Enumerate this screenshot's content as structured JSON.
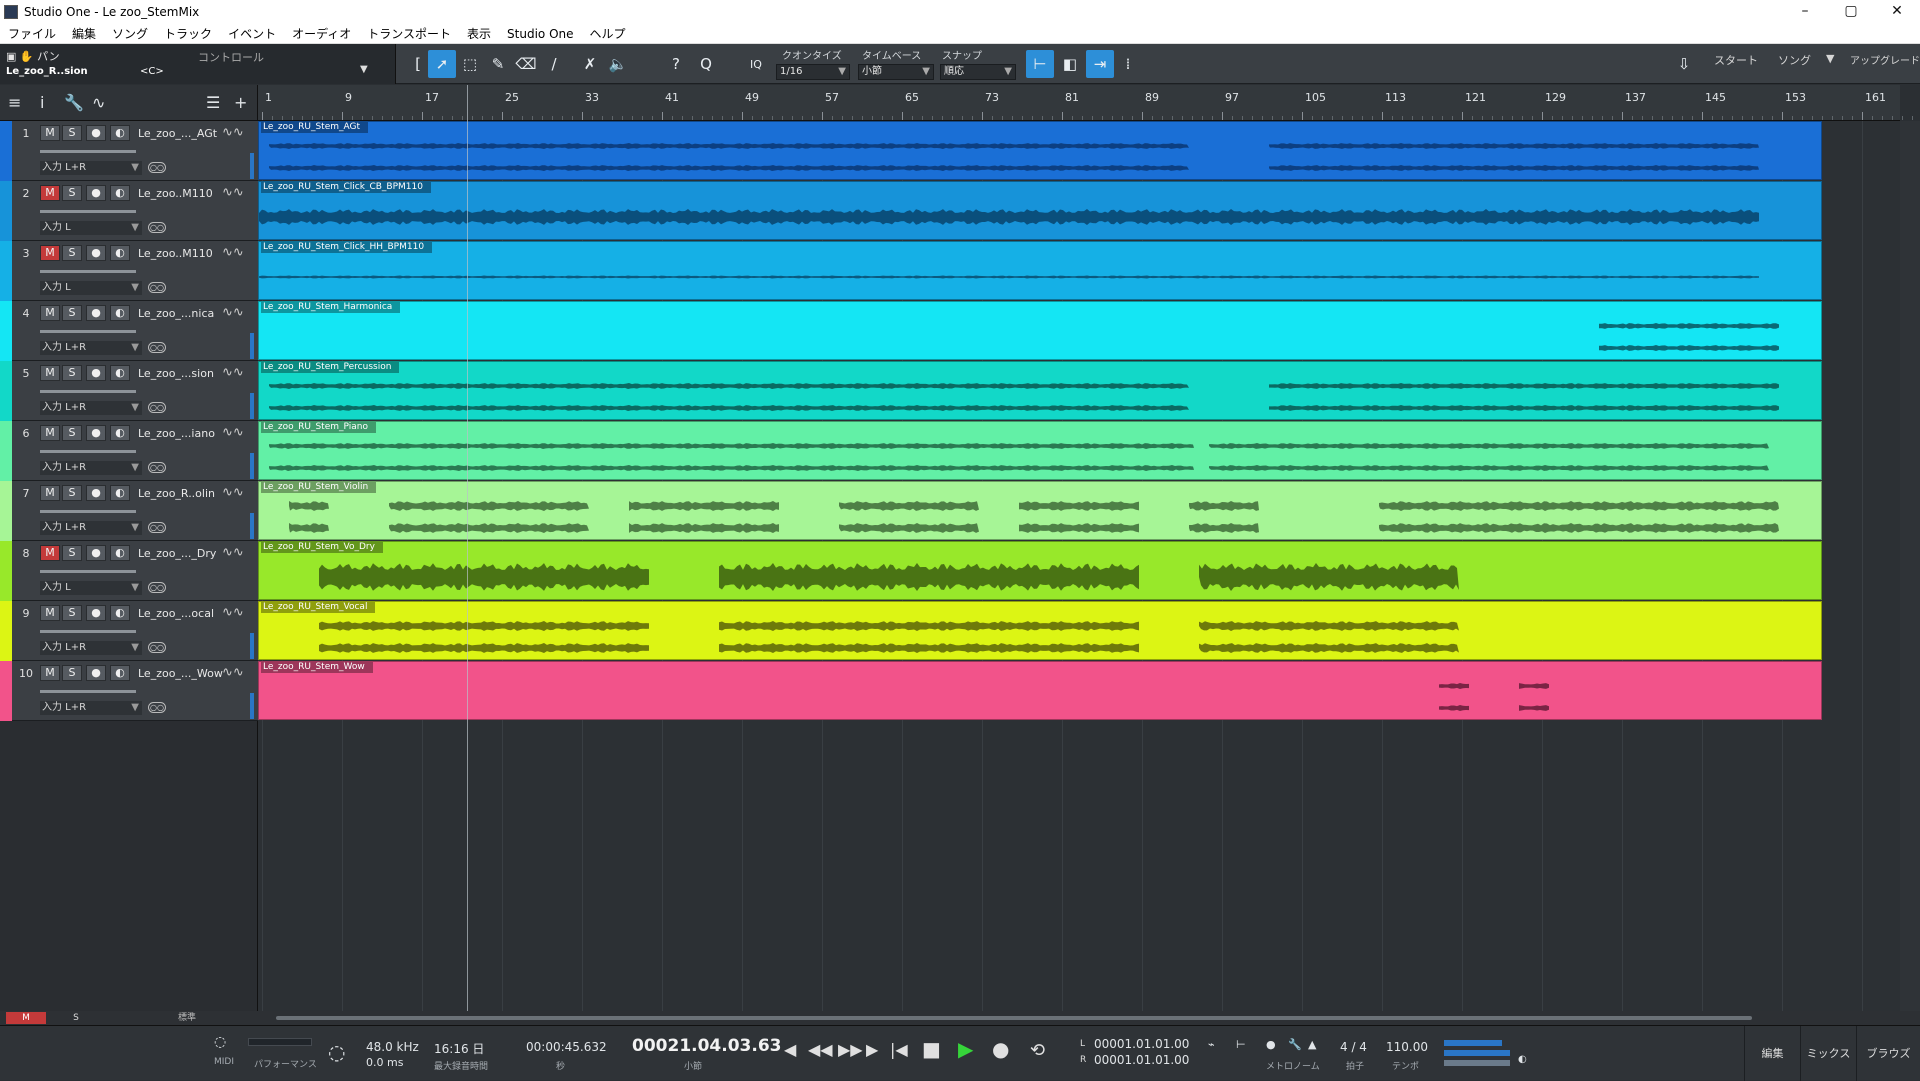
{
  "window": {
    "title": "Studio One - Le zoo_StemMix",
    "controls": [
      "–",
      "▢",
      "✕"
    ]
  },
  "menu": [
    "ファイル",
    "編集",
    "ソング",
    "トラック",
    "イベント",
    "オーディオ",
    "トランスポート",
    "表示",
    "Studio One",
    "ヘルプ"
  ],
  "toolbar": {
    "pan_label": "パン",
    "track_short": "Le_zoo_R..sion",
    "control_label": "コントロール",
    "center_value": "<C>",
    "iq_label": "IQ",
    "quantize_label": "クオンタイズ",
    "quantize_value": "1/16",
    "timebase_label": "タイムベース",
    "timebase_value": "小節",
    "snap_label": "スナップ",
    "snap_value": "順応",
    "start_label": "スタート",
    "song_label": "ソング",
    "upgrade_label": "アップグレード"
  },
  "ruler": {
    "labels": [
      "1",
      "9",
      "17",
      "25",
      "33",
      "41",
      "49",
      "57",
      "65",
      "73",
      "81",
      "89",
      "97",
      "105",
      "113",
      "121",
      "129",
      "137",
      "145",
      "153",
      "161"
    ]
  },
  "tracks": [
    {
      "num": "1",
      "name": "Le_zoo_..._AGt",
      "input": "入力 L+R",
      "mute": false,
      "color": "#1a6fd6",
      "strip": "#1a6fd6",
      "clip": "Le_zoo_RU_Stem_AGt",
      "wave": "#0c3f82"
    },
    {
      "num": "2",
      "name": "Le_zoo..M110",
      "input": "入力 L",
      "mute": true,
      "color": "#1793d9",
      "strip": "#1793d9",
      "clip": "Le_zoo_RU_Stem_Click_CB_BPM110",
      "wave": "#0a4f7c"
    },
    {
      "num": "3",
      "name": "Le_zoo..M110",
      "input": "入力 L",
      "mute": true,
      "color": "#15b0e6",
      "strip": "#15b0e6",
      "clip": "Le_zoo_RU_Stem_Click_HH_BPM110",
      "wave": "#0a5a80"
    },
    {
      "num": "4",
      "name": "Le_zoo_...nica",
      "input": "入力 L+R",
      "mute": false,
      "color": "#14e6f4",
      "strip": "#14e6f4",
      "clip": "Le_zoo_RU_Stem_Harmonica",
      "wave": "#0a6a76"
    },
    {
      "num": "5",
      "name": "Le_zoo_...sion",
      "input": "入力 L+R",
      "mute": false,
      "color": "#12d8c8",
      "strip": "#12d8c8",
      "clip": "Le_zoo_RU_Stem_Percussion",
      "wave": "#0a6a62"
    },
    {
      "num": "6",
      "name": "Le_zoo_...iano",
      "input": "入力 L+R",
      "mute": false,
      "color": "#62f0a6",
      "strip": "#62f0a6",
      "clip": "Le_zoo_RU_Stem_Piano",
      "wave": "#2a7a52"
    },
    {
      "num": "7",
      "name": "Le_zoo_R..olin",
      "input": "入力 L+R",
      "mute": false,
      "color": "#a6f596",
      "strip": "#a6f596",
      "clip": "Le_zoo_RU_Stem_Violin",
      "wave": "#4e8046"
    },
    {
      "num": "8",
      "name": "Le_zoo_..._Dry",
      "input": "入力 L",
      "mute": true,
      "color": "#98e82a",
      "strip": "#98e82a",
      "clip": "Le_zoo_RU_Stem_Vo_Dry",
      "wave": "#4a7414"
    },
    {
      "num": "9",
      "name": "Le_zoo_...ocal",
      "input": "入力 L+R",
      "mute": false,
      "color": "#dcf514",
      "strip": "#dcf514",
      "clip": "Le_zoo_RU_Stem_Vocal",
      "wave": "#6e7a0a"
    },
    {
      "num": "10",
      "name": "Le_zoo_..._Wow",
      "input": "入力 L+R",
      "mute": false,
      "color": "#f2538a",
      "strip": "#f2538a",
      "clip": "Le_zoo_RU_Stem_Wow",
      "wave": "#7a2444"
    }
  ],
  "bottom": {
    "m_label": "M",
    "s_label": "S",
    "std_label": "標準"
  },
  "transport": {
    "midi_label": "MIDI",
    "perf_label": "パフォーマンス",
    "sample_rate": "48.0 kHz",
    "latency": "0.0 ms",
    "rec_time": "16:16 日",
    "rec_time_label": "最大録音時間",
    "time": "00:00:45.632",
    "time_label": "秒",
    "bars": "00021.04.03.63",
    "bars_label": "小節",
    "loop_l": "00001.01.01.00",
    "loop_r": "00001.01.01.00",
    "l_label": "L",
    "r_label": "R",
    "metronome_label": "メトロノーム",
    "signature": "4 / 4",
    "signature_label": "拍子",
    "tempo": "110.00",
    "tempo_label": "テンポ",
    "edit_label": "編集",
    "mix_label": "ミックス",
    "browse_label": "ブラウズ"
  }
}
